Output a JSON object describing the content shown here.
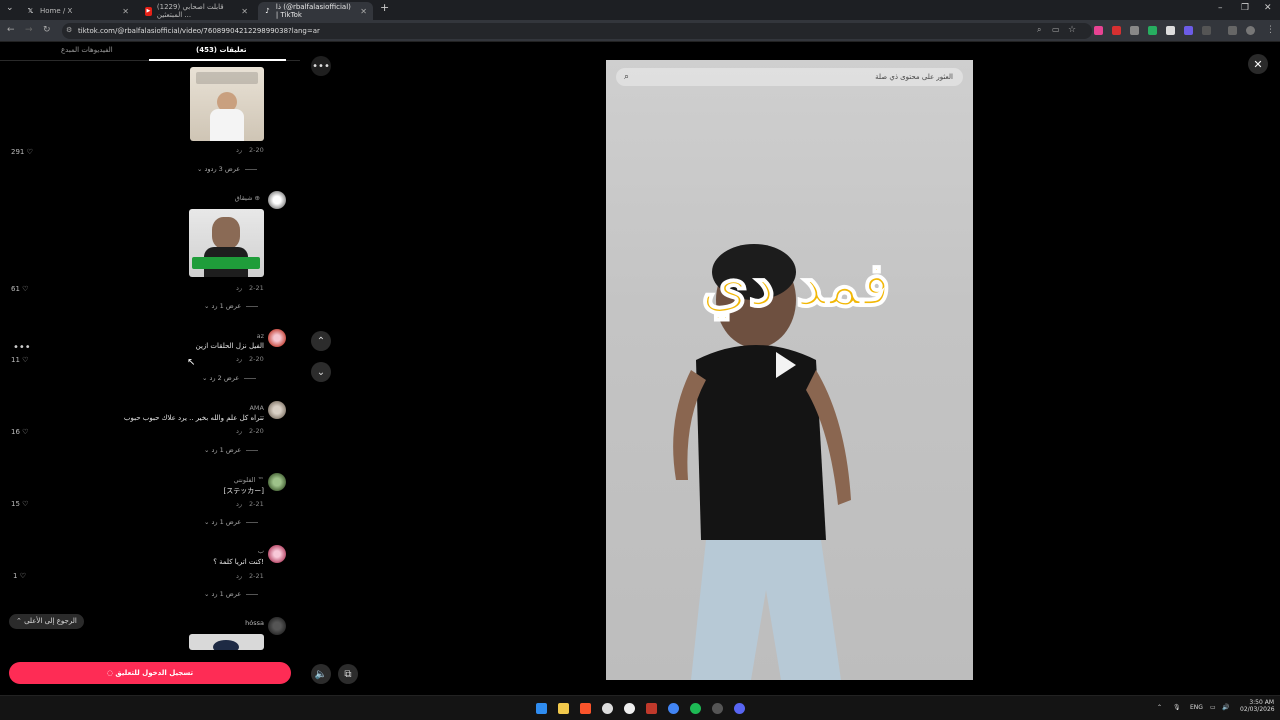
{
  "browser": {
    "tabs": [
      {
        "title": "Home / X",
        "favicon": "x-logo-icon"
      },
      {
        "title": "(1229) قابلت اصحابي المبتعثين ...",
        "favicon": "youtube-icon"
      },
      {
        "title": "ذا (@rbalfalasiofficial) | TikTok",
        "favicon": "tiktok-icon"
      }
    ],
    "url": "tiktok.com/@rbalfalasiofficial/video/7608990421229899038?lang=ar"
  },
  "panel": {
    "tab_videos": "الفيديوهات المبدع",
    "tab_comments": "(453) تعليقات",
    "back_to_top": "الرجوع إلى الأعلى",
    "login_button": "تسجيل الدخول للتعليق"
  },
  "comments": [
    {
      "date": "2-20",
      "reply": "رد",
      "view_replies": "عرض 3 ردود",
      "likes": "291"
    },
    {
      "user": "شيقاق ⊕",
      "date": "2-21",
      "reply": "رد",
      "view_replies": "عرض 1 رد",
      "likes": "61"
    },
    {
      "user": "az",
      "text": "الفيل نزل الحلقات ازين",
      "date": "2-20",
      "reply": "رد",
      "view_replies": "عرض 2 رد",
      "likes": "11"
    },
    {
      "user": "AMA",
      "text": "تتراه كل علم والله بخير .. يرد علاك حبوب حبوب",
      "date": "2-20",
      "reply": "رد",
      "view_replies": "عرض 1 رد",
      "likes": "16"
    },
    {
      "user": "الفلونتي ™",
      "text": "[ステッカー]",
      "date": "2-21",
      "reply": "رد",
      "view_replies": "عرض 1 رد",
      "likes": "15"
    },
    {
      "user": "ب",
      "text": "كنت اتريا كلمة ؟!",
      "date": "2-21",
      "reply": "رد",
      "view_replies": "عرض 1 رد",
      "likes": "1"
    },
    {
      "user": "hóssa"
    }
  ],
  "video": {
    "search_placeholder": "العثور على محتوى ذي صلة",
    "overlay_text": "فمد دي"
  },
  "taskbar": {
    "lang": "ENG",
    "time": "3:50 AM",
    "date": "02/03/2026"
  },
  "colors": {
    "accent": "#fe2c55"
  }
}
